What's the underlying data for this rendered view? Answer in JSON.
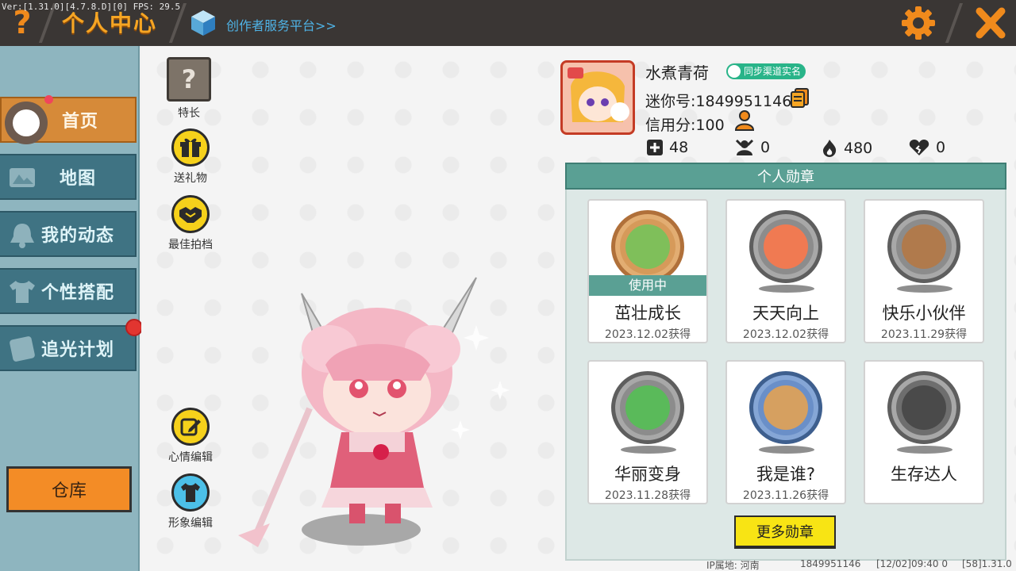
{
  "debug": {
    "version": "Ver:[1.31.0][4.7.8.D][0] FPS: 29.5"
  },
  "header": {
    "help_glyph": "?",
    "title": "个人中心",
    "platform_link": "创作者服务平台>>",
    "icons": [
      "help-icon",
      "cube-icon",
      "gear-icon",
      "close-icon"
    ]
  },
  "sidebar": {
    "items": [
      {
        "label": "首页",
        "active": true,
        "badge": true
      },
      {
        "label": "地图",
        "active": false,
        "icon": "map-icon"
      },
      {
        "label": "我的动态",
        "active": false,
        "icon": "bell-icon"
      },
      {
        "label": "个性搭配",
        "active": false,
        "icon": "shirt-icon"
      },
      {
        "label": "追光计划",
        "active": false,
        "icon": "plan-icon",
        "badge": true
      }
    ],
    "warehouse_label": "仓库"
  },
  "actions": {
    "specialty": {
      "glyph": "?",
      "label": "特长"
    },
    "gift": {
      "label": "送礼物"
    },
    "best_partner": {
      "label": "最佳拍档"
    },
    "mood_edit": {
      "label": "心情编辑"
    },
    "image_edit": {
      "label": "形象编辑"
    }
  },
  "profile": {
    "name": "水煮青荷",
    "real_name_badge": "同步渠道实名",
    "mini_id": "迷你号:1849951146",
    "credit": "信用分:100",
    "stats": [
      {
        "icon": "add-friend-icon",
        "value": "48"
      },
      {
        "icon": "follower-icon",
        "value": "0"
      },
      {
        "icon": "fire-icon",
        "value": "480"
      },
      {
        "icon": "heart-icon",
        "value": "0"
      }
    ]
  },
  "medals": {
    "title": "个人勋章",
    "using_label": "使用中",
    "items": [
      {
        "name": "茁壮成长",
        "date": "2023.12.02获得",
        "in_use": true,
        "color": "#7fbf5a"
      },
      {
        "name": "天天向上",
        "date": "2023.12.02获得",
        "in_use": false,
        "color": "#f07a52"
      },
      {
        "name": "快乐小伙伴",
        "date": "2023.11.29获得",
        "in_use": false,
        "color": "#b07a4c"
      },
      {
        "name": "华丽变身",
        "date": "2023.11.28获得",
        "in_use": false,
        "color": "#5aba5a"
      },
      {
        "name": "我是谁?",
        "date": "2023.11.26获得",
        "in_use": false,
        "color": "#6a8fc8"
      },
      {
        "name": "生存达人",
        "date": "",
        "in_use": false,
        "color": "#5e5e5e"
      }
    ],
    "more_label": "更多勋章"
  },
  "footer": {
    "ip_location": "IP属地: 河南",
    "uid": "1849951146",
    "timestamp": "[12/02]09:40 0",
    "build": "[58]1.31.0"
  }
}
